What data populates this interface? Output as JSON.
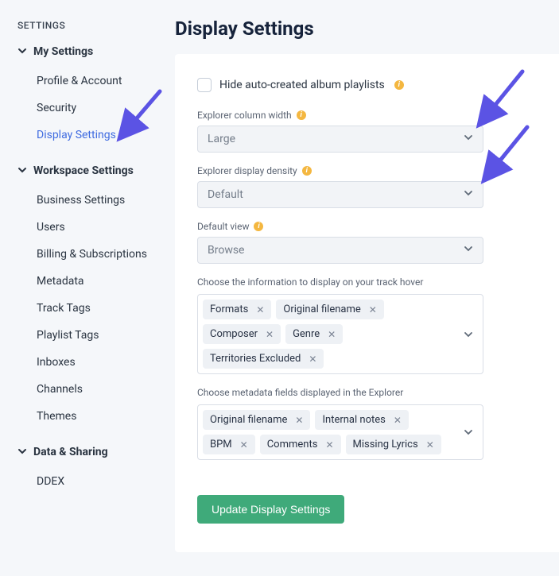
{
  "sidebar": {
    "title": "SETTINGS",
    "sections": [
      {
        "label": "My Settings",
        "items": [
          "Profile & Account",
          "Security",
          "Display Settings"
        ]
      },
      {
        "label": "Workspace Settings",
        "items": [
          "Business Settings",
          "Users",
          "Billing & Subscriptions",
          "Metadata",
          "Track Tags",
          "Playlist Tags",
          "Inboxes",
          "Channels",
          "Themes"
        ]
      },
      {
        "label": "Data & Sharing",
        "items": [
          "DDEX"
        ]
      }
    ]
  },
  "page": {
    "title": "Display Settings"
  },
  "form": {
    "hide_playlists_label": "Hide auto-created album playlists",
    "explorer_width_label": "Explorer column width",
    "explorer_width_value": "Large",
    "density_label": "Explorer display density",
    "density_value": "Default",
    "default_view_label": "Default view",
    "default_view_value": "Browse",
    "hover_label": "Choose the information to display on your track hover",
    "hover_tags": [
      "Formats",
      "Original filename",
      "Composer",
      "Genre",
      "Territories Excluded"
    ],
    "explorer_fields_label": "Choose metadata fields displayed in the Explorer",
    "explorer_fields_tags": [
      "Original filename",
      "Internal notes",
      "BPM",
      "Comments",
      "Missing Lyrics"
    ],
    "submit_label": "Update Display Settings"
  },
  "info_icon_text": "i"
}
